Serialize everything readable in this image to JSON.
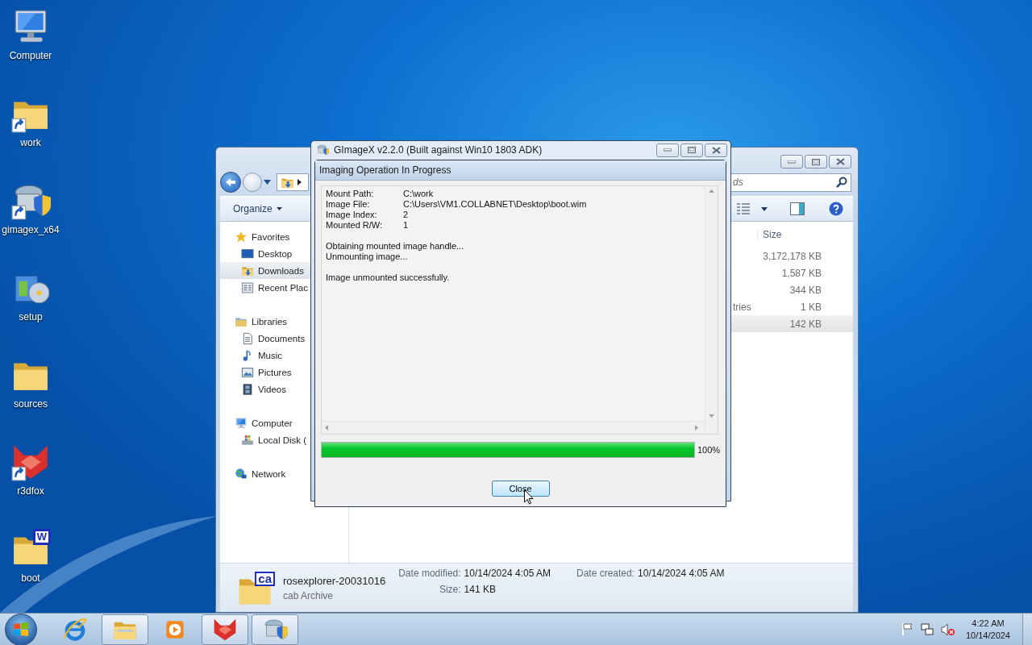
{
  "desktop_icons": [
    {
      "label": "Computer",
      "kind": "computer",
      "shortcut": false
    },
    {
      "label": "work",
      "kind": "folder",
      "shortcut": true
    },
    {
      "label": "gimagex_x64",
      "kind": "installer",
      "shortcut": true
    },
    {
      "label": "setup",
      "kind": "setup",
      "shortcut": false
    },
    {
      "label": "sources",
      "kind": "folder",
      "shortcut": false
    },
    {
      "label": "r3dfox",
      "kind": "fox",
      "shortcut": true
    },
    {
      "label": "boot",
      "kind": "folder",
      "shortcut": false,
      "badge": "W"
    }
  ],
  "explorer": {
    "search": {
      "placeholder": "ds"
    },
    "toolbar": {
      "organize": "Organize"
    },
    "nav": [
      {
        "label": "Favorites",
        "kind": "star",
        "selected": false,
        "children": [
          {
            "label": "Desktop",
            "kind": "desktop",
            "selected": false
          },
          {
            "label": "Downloads",
            "kind": "downloads",
            "selected": true
          },
          {
            "label": "Recent Plac",
            "kind": "recent",
            "selected": false
          }
        ]
      },
      {
        "label": "Libraries",
        "kind": "library",
        "selected": false,
        "children": [
          {
            "label": "Documents",
            "kind": "documents",
            "selected": false
          },
          {
            "label": "Music",
            "kind": "music",
            "selected": false
          },
          {
            "label": "Pictures",
            "kind": "pictures",
            "selected": false
          },
          {
            "label": "Videos",
            "kind": "videos",
            "selected": false
          }
        ]
      },
      {
        "label": "Computer",
        "kind": "computer",
        "selected": false,
        "children": [
          {
            "label": "Local Disk (",
            "kind": "disk",
            "selected": false
          }
        ]
      },
      {
        "label": "Network",
        "kind": "network",
        "selected": false
      }
    ],
    "columns": [
      "Size"
    ],
    "rows": [
      {
        "size": "3,172,178 KB",
        "selected": false
      },
      {
        "size": "1,587 KB",
        "selected": false
      },
      {
        "size": "344 KB",
        "selected": false
      },
      {
        "name": "tries",
        "size": "1 KB",
        "selected": false
      },
      {
        "size": "142 KB",
        "selected": true
      }
    ],
    "details": {
      "icon_text": "ca",
      "name": "rosexplorer-20031016",
      "type": "cab Archive",
      "fields": [
        {
          "label": "Date modified:",
          "value": "10/14/2024 4:05 AM"
        },
        {
          "label": "Size:",
          "value": "141 KB"
        },
        {
          "label": "Date created:",
          "value": "10/14/2024 4:05 AM"
        }
      ]
    }
  },
  "dialog": {
    "title": "GImageX v2.2.0 (Built against Win10 1803 ADK)",
    "heading": "Imaging Operation In Progress",
    "fields": [
      {
        "label": "Mount Path:",
        "value": "C:\\work"
      },
      {
        "label": "Image File:",
        "value": "C:\\Users\\VM1.COLLABNET\\Desktop\\boot.wim"
      },
      {
        "label": "Image Index:",
        "value": "2"
      },
      {
        "label": "Mounted R/W:",
        "value": "1"
      }
    ],
    "message_groups": [
      [
        "Obtaining mounted image handle...",
        "Unmounting image..."
      ],
      [
        "Image unmounted successfully."
      ]
    ],
    "progress": {
      "level": 1,
      "reading": "100%"
    },
    "button": "Close"
  },
  "taskbar": {
    "apps": [
      {
        "kind": "ie",
        "active": false
      },
      {
        "kind": "explorer",
        "active": true
      },
      {
        "kind": "media",
        "active": false
      },
      {
        "kind": "fox",
        "active": true
      },
      {
        "kind": "installer",
        "active": true
      }
    ],
    "clock": {
      "time": "4:22 AM",
      "date": "10/14/2024"
    }
  }
}
